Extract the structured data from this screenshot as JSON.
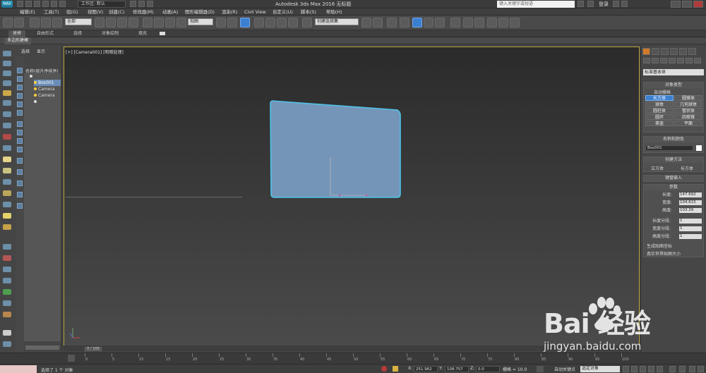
{
  "title_bar": {
    "app_title": "Autodesk 3ds Max 2016    无标题",
    "workspace": "工作区: 默认",
    "search_placeholder": "键入关键字或短语",
    "login": "登录"
  },
  "menu": [
    "编辑(E)",
    "工具(T)",
    "组(G)",
    "视图(V)",
    "创建(C)",
    "修改器(M)",
    "动画(A)",
    "图形编辑器(D)",
    "渲染(R)",
    "Civil View",
    "自定义(U)",
    "脚本(S)",
    "帮助(H)"
  ],
  "toolbar": {
    "selection_filter": "全部",
    "reference_coord": "视图",
    "selection_set": "创建选择集"
  },
  "ribbon": {
    "tabs": [
      "建模",
      "自由形式",
      "选择",
      "对象绘制",
      "填充"
    ],
    "sub_label": "多边形建模"
  },
  "scene_explorer": {
    "tabs": [
      "选择",
      "显示"
    ],
    "header": "名称(按升序排序)",
    "items": [
      {
        "label": "",
        "icon": "eye-icon"
      },
      {
        "label": "Box001",
        "icon": "box-icon",
        "selected": true
      },
      {
        "label": "Camera",
        "icon": "camera-icon"
      },
      {
        "label": "Camera",
        "icon": "camera-icon"
      },
      {
        "label": "",
        "icon": "eye-icon"
      }
    ]
  },
  "viewport": {
    "label": "[+] [Camera001] [明暗处理]"
  },
  "command_panel": {
    "category_dropdown": "标准基本体",
    "object_type_title": "对象类型",
    "auto_grid": "自动栅格",
    "object_buttons": [
      "长方体",
      "圆锥体",
      "球体",
      "几何球体",
      "圆柱体",
      "管状体",
      "圆环",
      "四棱锥",
      "茶壶",
      "平面"
    ],
    "name_color_title": "名称和颜色",
    "object_name": "Box001",
    "creation_method_title": "创建方法",
    "creation_methods": [
      "立方体",
      "长方体"
    ],
    "keyboard_entry_title": "键盘输入",
    "parameters_title": "参数",
    "params": [
      {
        "label": "长度:",
        "value": "147.692"
      },
      {
        "label": "宽度:",
        "value": "104.615"
      },
      {
        "label": "高度:",
        "value": "103.39"
      }
    ],
    "segments": [
      {
        "label": "长度分段:",
        "value": "1"
      },
      {
        "label": "宽度分段:",
        "value": "1"
      },
      {
        "label": "高度分段:",
        "value": "1"
      }
    ],
    "checks": [
      "生成贴图坐标",
      "真实世界贴图大小"
    ]
  },
  "timeline": {
    "slider": "0 / 100",
    "ticks": [
      "0",
      "5",
      "10",
      "15",
      "20",
      "25",
      "30",
      "35",
      "40",
      "45",
      "50",
      "55",
      "60",
      "65",
      "70",
      "75",
      "80",
      "85",
      "90",
      "95",
      "100"
    ]
  },
  "status": {
    "message": "选择了 1 个 对象",
    "x": "251.962",
    "y": "108.757",
    "z": "0.0",
    "grid": "栅格 = 10.0",
    "auto_key": "自动关键点",
    "key_filter": "选定对象"
  },
  "watermark": {
    "text": "Bai 经验",
    "url": "jingyan.baidu.com"
  },
  "colors": {
    "box_fill": "#7595b8",
    "box_edge": "#4fc3e8",
    "selected": "#3b7fd0",
    "viewport_border": "#b6a23e"
  }
}
